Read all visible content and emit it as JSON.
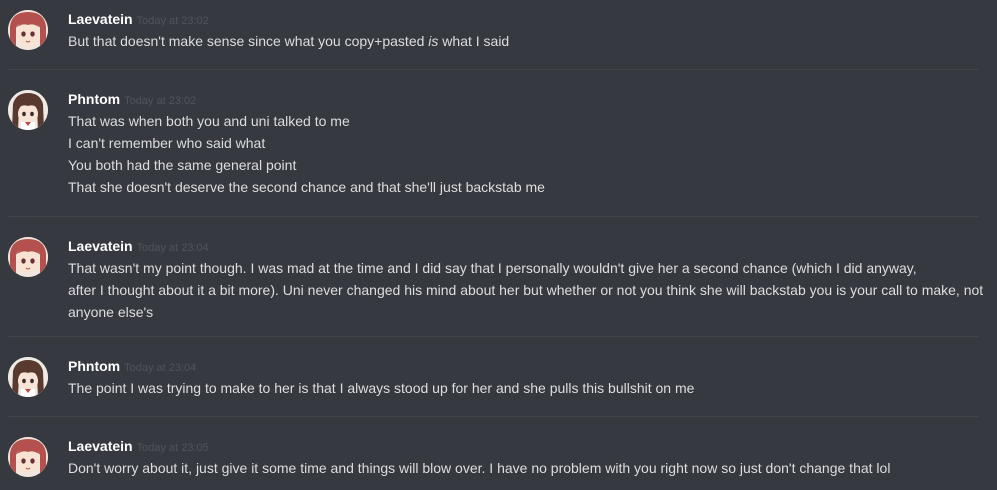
{
  "messages": [
    {
      "username": "Laevatein",
      "timestamp": "Today at 23:02",
      "avatar": "laevatein-avatar",
      "lines": [
        {
          "before": "But that doesn't make sense since what you copy+pasted ",
          "italic": "is",
          "after": " what I said"
        }
      ]
    },
    {
      "username": "Phntom",
      "timestamp": "Today at 23:02",
      "avatar": "phntom-avatar",
      "lines": [
        "That was when both you and uni talked to me",
        "I can't remember who said what",
        "You both had the same general point",
        "That she doesn't deserve the second chance and that she'll just backstab me"
      ]
    },
    {
      "username": "Laevatein",
      "timestamp": "Today at 23:04",
      "avatar": "laevatein-avatar",
      "lines": [
        "That wasn't my point though. I was mad at the time and I did say that I personally wouldn't give her a second chance (which I did anyway,",
        "after I thought about it a bit more). Uni never changed his mind about her but whether or not you think she will backstab you is your call to make, not",
        "anyone else's"
      ]
    },
    {
      "username": "Phntom",
      "timestamp": "Today at 23:04",
      "avatar": "phntom-avatar",
      "lines": [
        "The point I was trying to make to her is that I always stood up for her and she pulls this bullshit on me"
      ]
    },
    {
      "username": "Laevatein",
      "timestamp": "Today at 23:05",
      "avatar": "laevatein-avatar",
      "lines": [
        "Don't worry about it, just give it some time and things will blow over. I have no problem with you right now so just don't change that lol"
      ]
    }
  ]
}
